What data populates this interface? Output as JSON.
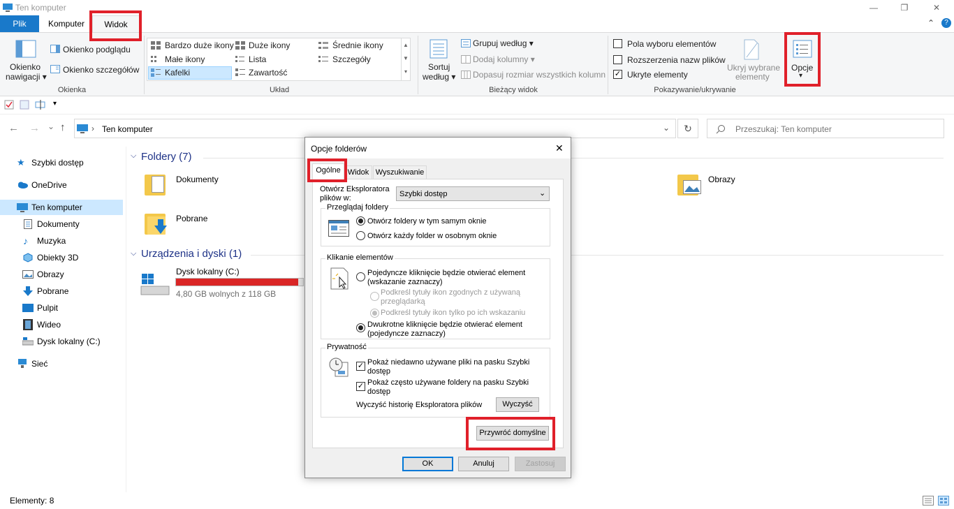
{
  "window": {
    "title": "Ten komputer",
    "minimize": "—",
    "restore": "❐",
    "close": "✕"
  },
  "ribbon_tabs": [
    "Plik",
    "Komputer",
    "Widok"
  ],
  "ribbon_collapse": "⌃",
  "help": "?",
  "ribbon": {
    "okienka": {
      "nav_pane": [
        "Okienko",
        "nawigacji ▾"
      ],
      "preview": "Okienko podglądu",
      "details": "Okienko szczegółów",
      "label": "Okienka"
    },
    "uklad": {
      "items": [
        "Bardzo duże ikony",
        "Duże ikony",
        "Średnie ikony",
        "Małe ikony",
        "Lista",
        "Szczegóły",
        "Kafelki",
        "Zawartość"
      ],
      "label": "Układ"
    },
    "biezacy": {
      "sort": [
        "Sortuj",
        "według ▾"
      ],
      "group": "Grupuj według ▾",
      "add_columns": "Dodaj kolumny ▾",
      "fit_columns": "Dopasuj rozmiar wszystkich kolumn",
      "label": "Bieżący widok"
    },
    "pokazywanie": {
      "checkbox_items": "Pola wyboru elementów",
      "extensions": "Rozszerzenia nazw plików",
      "hidden": "Ukryte elementy",
      "hide_selected": [
        "Ukryj wybrane",
        "elementy"
      ],
      "label": "Pokazywanie/ukrywanie"
    },
    "opcje": {
      "label": "Opcje",
      "arrow": "▾"
    }
  },
  "address": {
    "back": "←",
    "forward": "→",
    "recent": "⌄",
    "up": "↑",
    "path_sep": "›",
    "path": "Ten komputer",
    "dropdown": "⌄",
    "refresh": "↻",
    "search_placeholder": "Przeszukaj: Ten komputer"
  },
  "nav": [
    {
      "label": "Szybki dostęp",
      "icon": "star-icon"
    },
    {
      "label": "OneDrive",
      "icon": "cloud-icon"
    },
    {
      "label": "Ten komputer",
      "icon": "computer-icon"
    },
    {
      "label": "Dokumenty",
      "icon": "document-icon"
    },
    {
      "label": "Muzyka",
      "icon": "music-icon"
    },
    {
      "label": "Obiekty 3D",
      "icon": "cube-icon"
    },
    {
      "label": "Obrazy",
      "icon": "picture-icon"
    },
    {
      "label": "Pobrane",
      "icon": "download-icon"
    },
    {
      "label": "Pulpit",
      "icon": "desktop-icon"
    },
    {
      "label": "Wideo",
      "icon": "video-icon"
    },
    {
      "label": "Dysk lokalny (C:)",
      "icon": "drive-icon"
    },
    {
      "label": "Sieć",
      "icon": "network-icon"
    }
  ],
  "content": {
    "folders_header": "Foldery (7)",
    "folders": [
      "Dokumenty",
      "Pobrane",
      "Obrazy"
    ],
    "devices_header": "Urządzenia i dyski (1)",
    "drive": {
      "name": "Dysk lokalny (C:)",
      "info": "4,80 GB wolnych z 118 GB",
      "used_fraction": 0.96
    }
  },
  "status": {
    "items": "Elementy: 8"
  },
  "dialog": {
    "title": "Opcje folderów",
    "close": "✕",
    "tabs": [
      "Ogólne",
      "Widok",
      "Wyszukiwanie"
    ],
    "open_in_label": [
      "Otwórz Eksploratora",
      "plików w:"
    ],
    "open_in_value": "Szybki dostęp",
    "browse": {
      "legend": "Przeglądaj foldery",
      "same_window": "Otwórz foldery w tym samym oknie",
      "new_window": "Otwórz każdy folder w osobnym oknie"
    },
    "click": {
      "legend": "Klikanie elementów",
      "single": [
        "Pojedyncze kliknięcie będzie otwierać element",
        "(wskazanie zaznaczy)"
      ],
      "underline_browser": [
        "Podkreśl tytuły ikon zgodnych z używaną",
        "przeglądarką"
      ],
      "underline_hover": "Podkreśl tytuły ikon tylko po ich wskazaniu",
      "double": [
        "Dwukrotne kliknięcie będzie otwierać element",
        "(pojedyncze zaznaczy)"
      ]
    },
    "privacy": {
      "legend": "Prywatność",
      "recent_files": [
        "Pokaż niedawno używane pliki na pasku Szybki",
        "dostęp"
      ],
      "frequent_folders": [
        "Pokaż często używane foldery na pasku Szybki",
        "dostęp"
      ],
      "clear_label": "Wyczyść historię Eksploratora plików",
      "clear_button": "Wyczyść"
    },
    "restore_defaults": "Przywróć domyślne",
    "ok": "OK",
    "cancel": "Anuluj",
    "apply": "Zastosuj"
  },
  "colors": {
    "accent": "#0078d7",
    "highlight": "#e0202a",
    "selection": "#cce8ff",
    "drive_bar": "#da2626",
    "folder": "#f3c84a"
  }
}
